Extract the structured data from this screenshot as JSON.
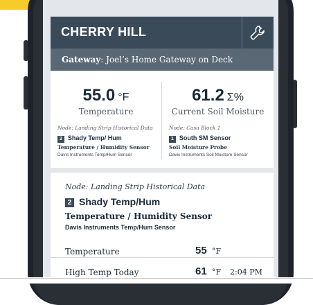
{
  "header": {
    "title": "CHERRY HILL"
  },
  "gateway": {
    "label": "Gateway",
    "value": ": Joel’s Home Gateway on Deck"
  },
  "summary": [
    {
      "value": "55.0",
      "unit": "°F",
      "label": "Temperature",
      "node": "Node: Landing Strip Historical Data",
      "badge": "2",
      "sensor": "Shady Temp/ Hum",
      "type": "Temperature / Humidity Sensor",
      "model": "Davis Instruments Temp/Hum Sensor"
    },
    {
      "value": "61.2",
      "unit": "Σ%",
      "label": "Current Soil Moisture",
      "node": "Node: Casa Block 1",
      "badge": "1",
      "sensor": "South SM Sensor",
      "type": "Soil Moisture Probe",
      "model": "Davis Instruments Soil Moisture Sensor"
    }
  ],
  "detail": {
    "node": "Node: Landing Strip Historical Data",
    "badge": "2",
    "sensor": "Shady Temp/Hum",
    "type": "Temperature / Humidity Sensor",
    "model": "Davis Instruments Temp/Hum Sensor",
    "rows": [
      {
        "label": "Temperature",
        "value": "55",
        "unit": "°F",
        "time": ""
      },
      {
        "label": "High Temp Today",
        "value": "61",
        "unit": "°F",
        "time": "2:04 PM"
      }
    ]
  },
  "colors": {
    "header": "#3b4a59",
    "gateway_bar": "#5a6876",
    "banner": "#f5cc2a",
    "phone": "#1f2329"
  },
  "icons": {
    "settings": "wrench-icon"
  }
}
